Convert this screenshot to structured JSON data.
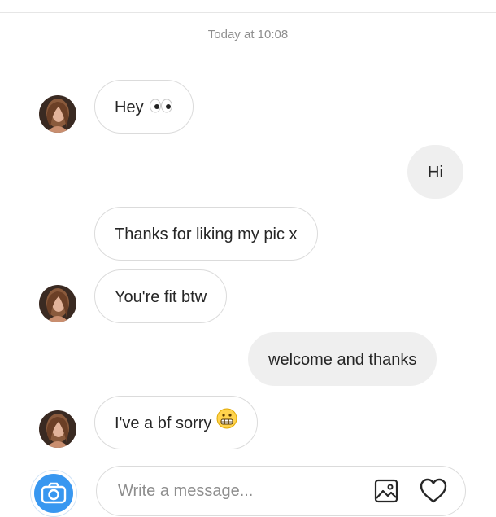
{
  "thread": {
    "timestamp": "Today at 10:08",
    "messages": [
      {
        "side": "incoming",
        "text": "Hey",
        "emoji": "eyes-emoji"
      },
      {
        "side": "outgoing",
        "text": "Hi"
      },
      {
        "side": "incoming",
        "text": "Thanks for liking my pic x"
      },
      {
        "side": "incoming",
        "text": "You're fit btw"
      },
      {
        "side": "outgoing",
        "text": "welcome and thanks"
      },
      {
        "side": "incoming",
        "text": "I've a bf sorry",
        "emoji": "grimacing-emoji"
      }
    ]
  },
  "composer": {
    "placeholder": "Write a message...",
    "icons": [
      "camera-icon",
      "gallery-icon",
      "heart-icon"
    ]
  },
  "colors": {
    "accent": "#3897f0",
    "incoming_border": "#dbdbdb",
    "outgoing_fill": "#efefef",
    "timestamp": "#8e8e8e"
  }
}
